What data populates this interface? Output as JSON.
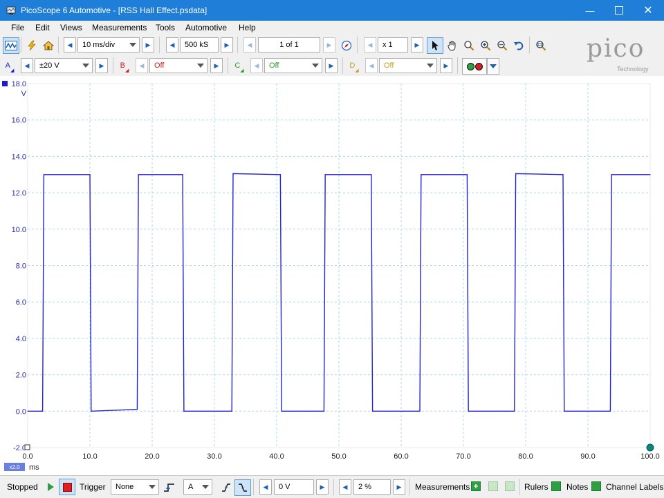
{
  "window": {
    "title": "PicoScope 6 Automotive - [RSS Hall Effect.psdata]"
  },
  "menu": [
    "File",
    "Edit",
    "Views",
    "Measurements",
    "Tools",
    "Automotive",
    "Help"
  ],
  "toolbar": {
    "timebase": "10 ms/div",
    "samples": "500 kS",
    "buffer": "1 of 1",
    "zoom": "x 1"
  },
  "channels": {
    "a": {
      "label": "A",
      "range": "±20 V",
      "color": "#1c1cd8"
    },
    "b": {
      "label": "B",
      "range": "Off",
      "color": "#d02020"
    },
    "c": {
      "label": "C",
      "range": "Off",
      "color": "#2a9d2a"
    },
    "d": {
      "label": "D",
      "range": "Off",
      "color": "#c0a020"
    }
  },
  "logo": {
    "text": "pico",
    "sub": "Technology"
  },
  "chart_data": {
    "type": "line",
    "xlabel": "ms",
    "ylabel": "V",
    "xlim": [
      0,
      100
    ],
    "ylim": [
      -2,
      18
    ],
    "x_ticks": [
      "0.0",
      "10.0",
      "20.0",
      "30.0",
      "40.0",
      "50.0",
      "60.0",
      "70.0",
      "80.0",
      "90.0",
      "100.0"
    ],
    "y_ticks": [
      "-2.0",
      "0.0",
      "2.0",
      "4.0",
      "6.0",
      "8.0",
      "10.0",
      "12.0",
      "14.0",
      "16.0",
      "18.0"
    ],
    "zoom_badge": "x2.0",
    "grid": true,
    "series": [
      {
        "color": "#2222d6",
        "x": [
          0,
          2.4,
          2.6,
          10.0,
          10.2,
          17.6,
          17.8,
          24.9,
          25.1,
          32.8,
          33.0,
          40.6,
          40.8,
          47.6,
          47.8,
          55.2,
          55.4,
          63.0,
          63.2,
          70.6,
          70.8,
          78.2,
          78.4,
          86.0,
          86.2,
          93.6,
          93.8,
          100
        ],
        "y": [
          0,
          0,
          13,
          13,
          0,
          0.1,
          13,
          13,
          0,
          0,
          13.05,
          13,
          0,
          0,
          13,
          13,
          0,
          0,
          13,
          13,
          0,
          0,
          13.05,
          13,
          0,
          0,
          13,
          13
        ]
      }
    ]
  },
  "status": {
    "state": "Stopped",
    "trigger_label": "Trigger",
    "trigger_mode": "None",
    "trigger_channel": "A",
    "threshold": "0 V",
    "pretrigger": "2 %",
    "measurements": "Measurements",
    "rulers": "Rulers",
    "notes": "Notes",
    "channel_labels": "Channel Labels"
  }
}
